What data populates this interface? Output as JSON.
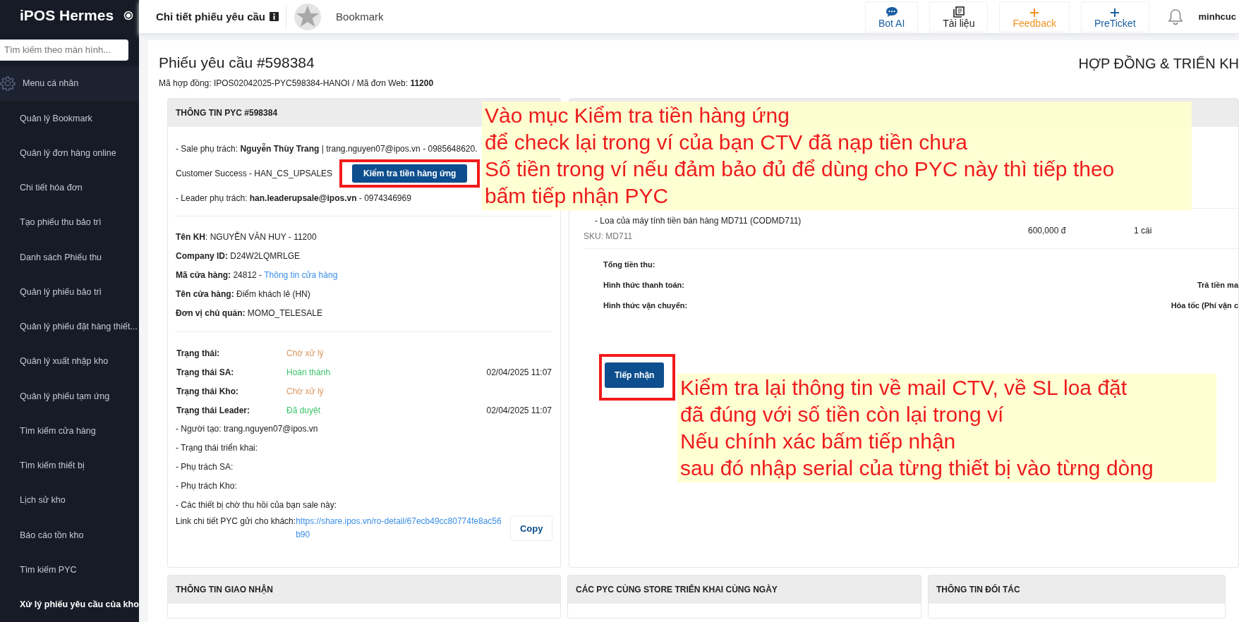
{
  "app": {
    "name": "iPOS Hermes"
  },
  "search": {
    "placeholder": "Tìm kiếm theo màn hình..."
  },
  "sidebar": {
    "items": [
      {
        "label": "Menu cá nhân",
        "kind": "header",
        "selected": false
      },
      {
        "label": "Quản lý Bookmark",
        "kind": "link",
        "selected": false
      },
      {
        "label": "Quản lý đơn hàng online",
        "kind": "link",
        "selected": false
      },
      {
        "label": "Chi tiết hóa đơn",
        "kind": "link",
        "selected": false
      },
      {
        "label": "Tạo phiếu thu bảo trì",
        "kind": "link",
        "selected": false
      },
      {
        "label": "Danh sách Phiếu thu",
        "kind": "link",
        "selected": false
      },
      {
        "label": "Quản lý phiếu bảo trì",
        "kind": "link",
        "selected": false
      },
      {
        "label": "Quản lý phiếu đặt hàng thiết...",
        "kind": "link",
        "selected": false
      },
      {
        "label": "Quản lý xuất nhập kho",
        "kind": "link",
        "selected": false
      },
      {
        "label": "Quản lý phiếu tạm ứng",
        "kind": "link",
        "selected": false
      },
      {
        "label": "Tìm kiếm cửa hàng",
        "kind": "link",
        "selected": false
      },
      {
        "label": "Tìm kiếm thiết bị",
        "kind": "link",
        "selected": false
      },
      {
        "label": "Lịch sử kho",
        "kind": "link",
        "selected": false
      },
      {
        "label": "Báo cáo tồn kho",
        "kind": "link",
        "selected": false
      },
      {
        "label": "Tìm kiếm PYC",
        "kind": "link",
        "selected": false
      },
      {
        "label": "Xử lý phiếu yêu cầu của kho",
        "kind": "link",
        "selected": true
      }
    ]
  },
  "topbar": {
    "title": "Chi tiết phiếu yêu cầu",
    "bookmark": "Bookmark",
    "user": "minhcuc",
    "buttons": [
      {
        "label": "Bot AI",
        "kind": "chat",
        "color": "#1a5fa0"
      },
      {
        "label": "Tài liệu",
        "kind": "book",
        "color": "#222222"
      },
      {
        "label": "Feedback",
        "kind": "plus",
        "color": "#f0931e"
      },
      {
        "label": "PreTicket",
        "kind": "plus",
        "color": "#1a5fa0"
      }
    ]
  },
  "page": {
    "title": "Phiếu yêu cầu #598384",
    "contract": "Mã hợp đồng: IPOS02042025-PYC598384-HANOI / Mã đơn Web: **11200**",
    "section_right": "HỢP ĐỒNG & TRIỂN KH"
  },
  "info_panel": {
    "title": "THÔNG TIN PYC #598384",
    "sale": "- Sale phụ trách: **Nguyễn Thùy Trang** | trang.nguyen07@ipos.vn - 0985648620.",
    "team": "Customer Success - HAN_CS_UPSALES",
    "check_button": "Kiểm tra tiền hàng ứng",
    "leader": "- Leader phụ trách: **han.leaderupsale@ipos.vn** - 0974346969",
    "fields": [
      {
        "label": "Tên KH",
        "value": ": NGUYỄN VĂN HUY - 11200"
      },
      {
        "label": "Company ID:",
        "value": " D24W2LQMRLGE"
      },
      {
        "label": "Mã cửa hàng:",
        "value": " 24812 - ",
        "link": "Thông tin cửa hàng"
      },
      {
        "label": "Tên cửa hàng:",
        "value": " Điểm khách lẻ (HN)"
      },
      {
        "label": "Đơn vị chủ quản:",
        "value": " MOMO_TELESALE"
      }
    ],
    "statuses": [
      {
        "label": "Trạng thái:",
        "value": "Chờ xử lý",
        "color": "#d9965f"
      },
      {
        "label": "Trạng thái SA:",
        "value": "Hoàn thành",
        "color": "#3cc36b",
        "time": "02/04/2025 11:07"
      },
      {
        "label": "Trạng thái Kho:",
        "value": "Chờ xử lý",
        "color": "#d9965f"
      },
      {
        "label": "Trạng thái Leader:",
        "value": "Đã duyệt",
        "color": "#3cc36b",
        "time": "02/04/2025 11:07"
      }
    ],
    "notes": [
      "- Người tạo: trang.nguyen07@ipos.vn",
      "- Trạng thái triển khai:",
      "- Phụ trách SA:",
      "- Phụ trách Kho:",
      "- Các thiết bị chờ thu hồi của bạn sale này:"
    ],
    "link_label": "Link chi tiết PYC gửi cho khách: ",
    "link_url": "https://share.ipos.vn/ro-detail/67ecb49cc80774fe8ac56b90",
    "copy_button": "Copy"
  },
  "order_panel": {
    "items": [
      {
        "name": "- Loa của máy tính tiền bán hàng MD711 (CODMD711)",
        "sku": "SKU: MD711",
        "price": "600,000 đ",
        "quantity": "1 cái"
      }
    ],
    "summary": [
      {
        "label": "Tổng tiền thu:"
      },
      {
        "label": "Hình thức thanh toán:",
        "value": "Trả tiền ma"
      },
      {
        "label": "Hình thức vận chuyển:",
        "value": "Hỏa tốc (Phí vận c"
      }
    ],
    "accept_button": "Tiếp nhận"
  },
  "bottom_panels": [
    {
      "title": "THÔNG TIN GIAO NHẬN"
    },
    {
      "title": "CÁC PYC CÙNG STORE TRIỂN KHAI CÙNG NGÀY"
    },
    {
      "title": "THÔNG TIN ĐỐI TÁC"
    }
  ],
  "annotations": [
    {
      "lines": [
        "Vào mục Kiểm tra tiền hàng ứng",
        "để check lại trong ví của bạn CTV đã nạp tiền chưa",
        "Số tiền trong ví nếu đảm bảo đủ để dùng cho PYC này thì tiếp theo",
        "bấm tiếp nhận PYC"
      ]
    },
    {
      "lines": [
        "Kiểm tra lại thông tin về mail CTV, về SL loa đặt",
        "đã đúng với số tiền còn lại trong ví",
        "Nếu chính xác bấm tiếp nhận",
        "sau đó nhập serial của từng thiết bị vào từng dòng"
      ]
    }
  ]
}
